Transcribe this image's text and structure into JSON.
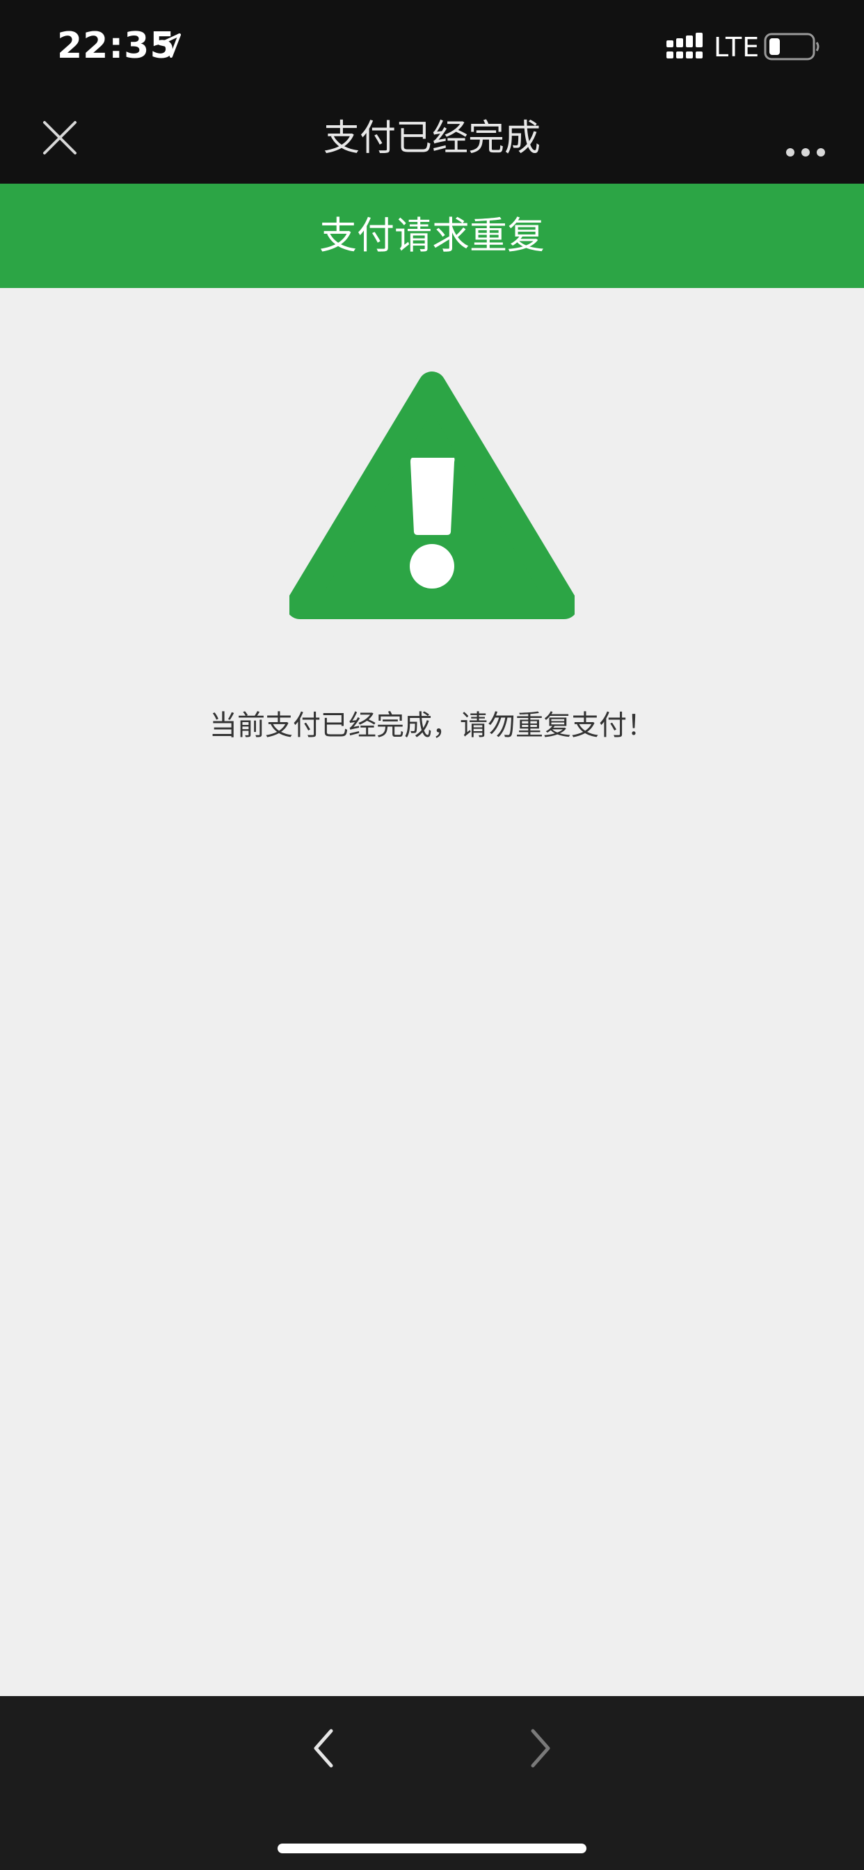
{
  "status_bar": {
    "time": "22:35",
    "network": "LTE",
    "icons": [
      "location-arrow-icon",
      "signal-icon",
      "battery-icon"
    ]
  },
  "nav_bar": {
    "title": "支付已经完成",
    "left_icon": "close-icon",
    "right_icon": "more-icon"
  },
  "banner": {
    "title": "支付请求重复"
  },
  "main": {
    "icon": "warning-icon",
    "message": "当前支付已经完成，请勿重复支付！"
  },
  "toolbar": {
    "back_icon": "chevron-left-icon",
    "forward_icon": "chevron-right-icon"
  },
  "colors": {
    "brand_green": "#2ca545",
    "status_bar_bg": "#111111",
    "page_bg": "#efefef",
    "toolbar_bg": "#1c1c1c"
  }
}
